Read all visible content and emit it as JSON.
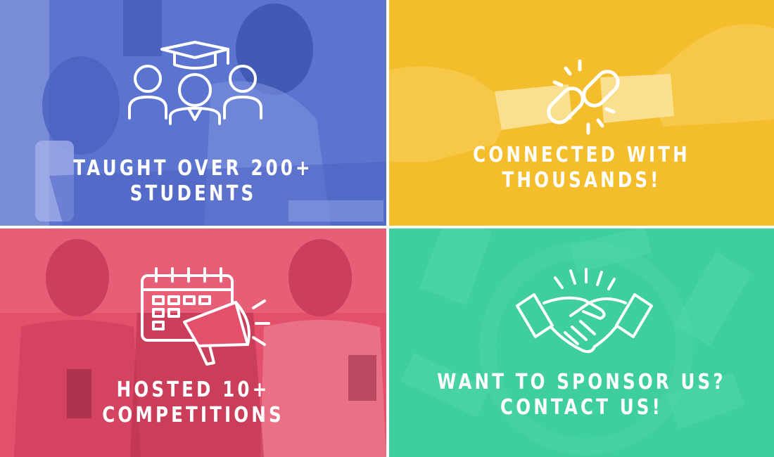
{
  "tiles": {
    "students": {
      "line1": "TAUGHT OVER 200+",
      "line2": "STUDENTS",
      "icon": "students-graduation-icon",
      "color": "#5b74cf"
    },
    "connected": {
      "line1": "CONNECTED WITH",
      "line2": "THOUSANDS!",
      "icon": "chain-link-icon",
      "color": "#f1b81f"
    },
    "competitions": {
      "line1": "HOSTED 10+",
      "line2": "COMPETITIONS",
      "icon": "calendar-megaphone-icon",
      "color": "#e4506c"
    },
    "sponsor": {
      "line1": "WANT TO SPONSOR US?",
      "line2": "CONTACT US!",
      "icon": "handshake-icon",
      "color": "#3ecf9c"
    }
  }
}
